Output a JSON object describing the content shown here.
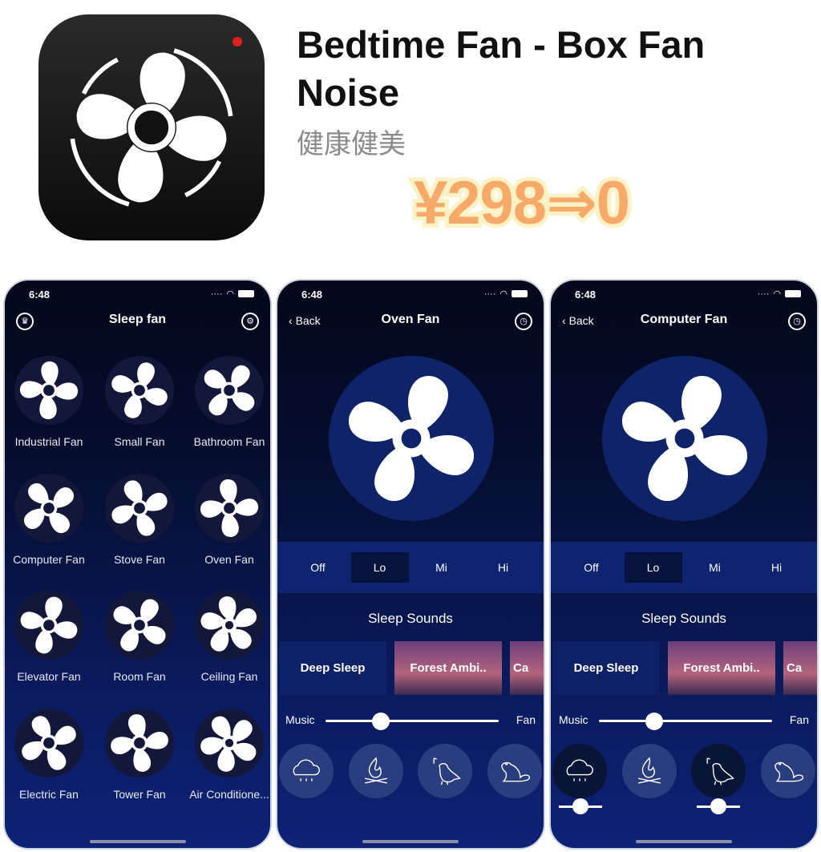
{
  "app": {
    "title": "Bedtime Fan - Box Fan Noise",
    "category": "健康健美",
    "price_promo": "¥298⇒0"
  },
  "status": {
    "time": "6:48"
  },
  "screen1": {
    "title": "Sleep fan",
    "left_icon": "crown-icon",
    "right_icon": "gear-icon",
    "fans": [
      "Industrial Fan",
      "Small Fan",
      "Bathroom Fan",
      "Computer Fan",
      "Stove Fan",
      "Oven Fan",
      "Elevator Fan",
      "Room Fan",
      "Ceiling Fan",
      "Electric Fan",
      "Tower Fan",
      "Air Conditione..."
    ]
  },
  "screen2": {
    "back": "Back",
    "title": "Oven Fan",
    "speeds": [
      "Off",
      "Lo",
      "Mi",
      "Hi"
    ],
    "selected_speed": "Lo",
    "sleep_sounds": "Sleep Sounds",
    "cards": [
      "Deep Sleep",
      "Forest Ambi..",
      "Ca"
    ],
    "mix_left": "Music",
    "mix_right": "Fan",
    "mix_value": 0.32
  },
  "screen3": {
    "back": "Back",
    "title": "Computer Fan",
    "speeds": [
      "Off",
      "Lo",
      "Mi",
      "Hi"
    ],
    "selected_speed": "Lo",
    "sleep_sounds": "Sleep Sounds",
    "cards": [
      "Deep Sleep",
      "Forest Ambi..",
      "Ca"
    ],
    "mix_left": "Music",
    "mix_right": "Fan",
    "mix_value": 0.32,
    "rain_volume": 0.5,
    "bird_volume": 0.5
  },
  "sounds": [
    "rain-icon",
    "campfire-icon",
    "bird-icon",
    "frog-icon"
  ]
}
